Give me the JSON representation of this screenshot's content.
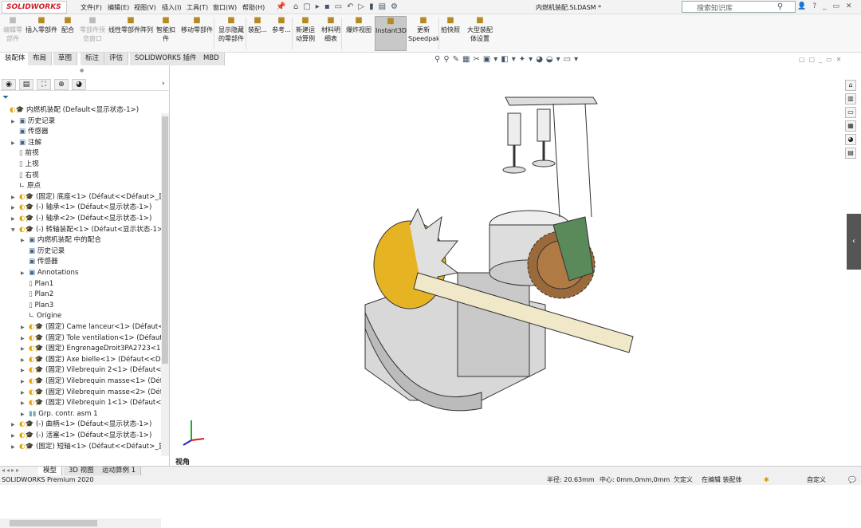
{
  "app": {
    "logo": "SOLIDWORKS",
    "doc_title": "内燃机装配.SLDASM *"
  },
  "menu": [
    "文件(F)",
    "编辑(E)",
    "视图(V)",
    "插入(I)",
    "工具(T)",
    "窗口(W)",
    "帮助(H)"
  ],
  "search": {
    "placeholder": "搜索知识库"
  },
  "ribbon": [
    {
      "label": "编辑零\n部件",
      "disabled": true,
      "icon": "edit-component-icon"
    },
    {
      "label": "插入零部件",
      "icon": "insert-component-icon"
    },
    {
      "label": "配合",
      "icon": "mate-icon"
    },
    {
      "label": "零部件预\n览窗口",
      "disabled": true,
      "icon": "preview-icon"
    },
    {
      "label": "线性零部件阵列",
      "icon": "pattern-icon"
    },
    {
      "label": "智能扣\n件",
      "icon": "fastener-icon"
    },
    {
      "label": "移动零部件",
      "icon": "move-icon"
    },
    {
      "label": "显示隐藏\n的零部件",
      "icon": "show-hidden-icon"
    },
    {
      "label": "装配...",
      "icon": "assembly-icon"
    },
    {
      "label": "参考...",
      "icon": "reference-icon"
    },
    {
      "label": "新建运\n动算例",
      "icon": "motion-study-icon"
    },
    {
      "label": "材料明\n细表",
      "icon": "bom-icon"
    },
    {
      "label": "爆炸视图",
      "icon": "explode-icon"
    },
    {
      "label": "Instant3D",
      "active": true,
      "icon": "instant3d-icon"
    },
    {
      "label": "更新\nSpeedpak",
      "icon": "speedpak-icon"
    },
    {
      "label": "拍快照",
      "icon": "camera-icon"
    },
    {
      "label": "大型装配\n体设置",
      "icon": "large-assembly-icon"
    }
  ],
  "tabs": [
    "装配体",
    "布局",
    "草图",
    "标注",
    "评估",
    "SOLIDWORKS 插件",
    "MBD"
  ],
  "tree": [
    {
      "t": "内燃机装配  (Default<显示状态-1>)",
      "l": 0,
      "ic": "comp",
      "ar": false
    },
    {
      "t": "历史记录",
      "l": 1,
      "ic": "folder",
      "ar": true
    },
    {
      "t": "传感器",
      "l": 1,
      "ic": "folder",
      "ar": false
    },
    {
      "t": "注解",
      "l": 1,
      "ic": "folder",
      "ar": true
    },
    {
      "t": "前视",
      "l": 1,
      "ic": "plane",
      "ar": false
    },
    {
      "t": "上视",
      "l": 1,
      "ic": "plane",
      "ar": false
    },
    {
      "t": "右视",
      "l": 1,
      "ic": "plane",
      "ar": false
    },
    {
      "t": "原点",
      "l": 1,
      "ic": "origin",
      "ar": false
    },
    {
      "t": "(固定) 底座<1> (Défaut<<Défaut>_显示状",
      "l": 1,
      "ic": "comp",
      "ar": true
    },
    {
      "t": "(-) 轴承<1> (Défaut<显示状态-1>)",
      "l": 1,
      "ic": "comp",
      "ar": true
    },
    {
      "t": "(-) 轴承<2> (Défaut<显示状态-1>)",
      "l": 1,
      "ic": "comp",
      "ar": true
    },
    {
      "t": "(-) 转轴装配<1> (Défaut<显示状态-1>)",
      "l": 1,
      "ic": "comp",
      "ar": true,
      "open": true
    },
    {
      "t": "内燃机装配 中的配合",
      "l": 2,
      "ic": "folder",
      "ar": true
    },
    {
      "t": "历史记录",
      "l": 2,
      "ic": "folder",
      "ar": false
    },
    {
      "t": "传感器",
      "l": 2,
      "ic": "folder",
      "ar": false
    },
    {
      "t": "Annotations",
      "l": 2,
      "ic": "folder",
      "ar": true
    },
    {
      "t": "Plan1",
      "l": 2,
      "ic": "plane",
      "ar": false
    },
    {
      "t": "Plan2",
      "l": 2,
      "ic": "plane",
      "ar": false
    },
    {
      "t": "Plan3",
      "l": 2,
      "ic": "plane",
      "ar": false
    },
    {
      "t": "Origine",
      "l": 2,
      "ic": "origin",
      "ar": false
    },
    {
      "t": "(固定) Came lanceur<1> (Défaut<<Défaut",
      "l": 2,
      "ic": "comp",
      "ar": true
    },
    {
      "t": "(固定) Tole ventilation<1> (Défaut<<Dé",
      "l": 2,
      "ic": "comp",
      "ar": true
    },
    {
      "t": "(固定) EngrenageDroit3PA2723<1> (Dé",
      "l": 2,
      "ic": "comp",
      "ar": true
    },
    {
      "t": "(固定) Axe bielle<1> (Défaut<<Défaut",
      "l": 2,
      "ic": "comp",
      "ar": true
    },
    {
      "t": "(固定) Vilebrequin 2<1> (Défaut<<Dé",
      "l": 2,
      "ic": "comp",
      "ar": true
    },
    {
      "t": "(固定) Vilebrequin masse<1> (Défaut",
      "l": 2,
      "ic": "comp",
      "ar": true
    },
    {
      "t": "(固定) Vilebrequin masse<2> (Défaut",
      "l": 2,
      "ic": "comp",
      "ar": true
    },
    {
      "t": "(固定) Vilebrequin 1<1> (Défaut<<Dé",
      "l": 2,
      "ic": "comp",
      "ar": true
    },
    {
      "t": "Grp. contr. asm 1",
      "l": 2,
      "ic": "group",
      "ar": true
    },
    {
      "t": "(-) 曲柄<1> (Défaut<显示状态-1>)",
      "l": 1,
      "ic": "comp",
      "ar": true
    },
    {
      "t": "(-) 活塞<1> (Défaut<显示状态-1>)",
      "l": 1,
      "ic": "comp",
      "ar": true
    },
    {
      "t": "(固定) 短轴<1> (Défaut<<Défaut>_显示状",
      "l": 1,
      "ic": "comp",
      "ar": true
    }
  ],
  "viewport": {
    "view_label": "视角"
  },
  "bottom_tabs": [
    "模型",
    "3D 视图",
    "运动算例 1"
  ],
  "status": {
    "product": "SOLIDWORKS Premium 2020",
    "radius": "半径: 20.63mm",
    "center": "中心: 0mm,0mm,0mm",
    "definition": "欠定义",
    "mode": "在编辑 装配体",
    "units": "自定义"
  }
}
